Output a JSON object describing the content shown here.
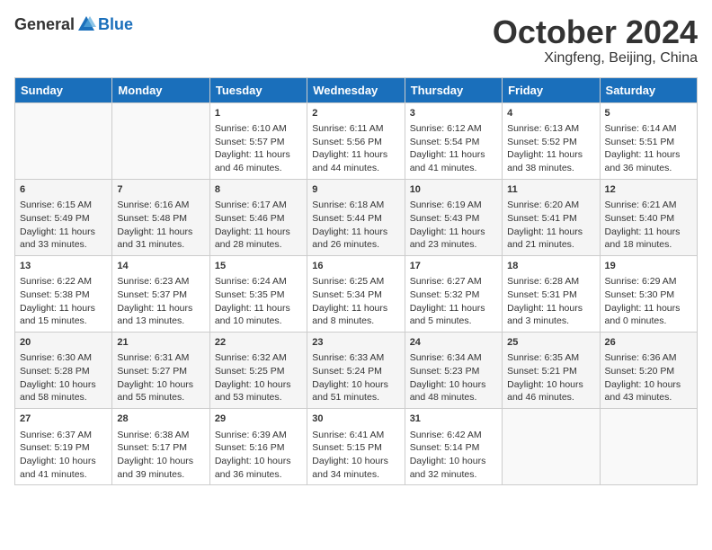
{
  "header": {
    "logo": {
      "general": "General",
      "blue": "Blue"
    },
    "month": "October 2024",
    "location": "Xingfeng, Beijing, China"
  },
  "weekdays": [
    "Sunday",
    "Monday",
    "Tuesday",
    "Wednesday",
    "Thursday",
    "Friday",
    "Saturday"
  ],
  "weeks": [
    [
      {
        "day": "",
        "sunrise": "",
        "sunset": "",
        "daylight": ""
      },
      {
        "day": "",
        "sunrise": "",
        "sunset": "",
        "daylight": ""
      },
      {
        "day": "1",
        "sunrise": "Sunrise: 6:10 AM",
        "sunset": "Sunset: 5:57 PM",
        "daylight": "Daylight: 11 hours and 46 minutes."
      },
      {
        "day": "2",
        "sunrise": "Sunrise: 6:11 AM",
        "sunset": "Sunset: 5:56 PM",
        "daylight": "Daylight: 11 hours and 44 minutes."
      },
      {
        "day": "3",
        "sunrise": "Sunrise: 6:12 AM",
        "sunset": "Sunset: 5:54 PM",
        "daylight": "Daylight: 11 hours and 41 minutes."
      },
      {
        "day": "4",
        "sunrise": "Sunrise: 6:13 AM",
        "sunset": "Sunset: 5:52 PM",
        "daylight": "Daylight: 11 hours and 38 minutes."
      },
      {
        "day": "5",
        "sunrise": "Sunrise: 6:14 AM",
        "sunset": "Sunset: 5:51 PM",
        "daylight": "Daylight: 11 hours and 36 minutes."
      }
    ],
    [
      {
        "day": "6",
        "sunrise": "Sunrise: 6:15 AM",
        "sunset": "Sunset: 5:49 PM",
        "daylight": "Daylight: 11 hours and 33 minutes."
      },
      {
        "day": "7",
        "sunrise": "Sunrise: 6:16 AM",
        "sunset": "Sunset: 5:48 PM",
        "daylight": "Daylight: 11 hours and 31 minutes."
      },
      {
        "day": "8",
        "sunrise": "Sunrise: 6:17 AM",
        "sunset": "Sunset: 5:46 PM",
        "daylight": "Daylight: 11 hours and 28 minutes."
      },
      {
        "day": "9",
        "sunrise": "Sunrise: 6:18 AM",
        "sunset": "Sunset: 5:44 PM",
        "daylight": "Daylight: 11 hours and 26 minutes."
      },
      {
        "day": "10",
        "sunrise": "Sunrise: 6:19 AM",
        "sunset": "Sunset: 5:43 PM",
        "daylight": "Daylight: 11 hours and 23 minutes."
      },
      {
        "day": "11",
        "sunrise": "Sunrise: 6:20 AM",
        "sunset": "Sunset: 5:41 PM",
        "daylight": "Daylight: 11 hours and 21 minutes."
      },
      {
        "day": "12",
        "sunrise": "Sunrise: 6:21 AM",
        "sunset": "Sunset: 5:40 PM",
        "daylight": "Daylight: 11 hours and 18 minutes."
      }
    ],
    [
      {
        "day": "13",
        "sunrise": "Sunrise: 6:22 AM",
        "sunset": "Sunset: 5:38 PM",
        "daylight": "Daylight: 11 hours and 15 minutes."
      },
      {
        "day": "14",
        "sunrise": "Sunrise: 6:23 AM",
        "sunset": "Sunset: 5:37 PM",
        "daylight": "Daylight: 11 hours and 13 minutes."
      },
      {
        "day": "15",
        "sunrise": "Sunrise: 6:24 AM",
        "sunset": "Sunset: 5:35 PM",
        "daylight": "Daylight: 11 hours and 10 minutes."
      },
      {
        "day": "16",
        "sunrise": "Sunrise: 6:25 AM",
        "sunset": "Sunset: 5:34 PM",
        "daylight": "Daylight: 11 hours and 8 minutes."
      },
      {
        "day": "17",
        "sunrise": "Sunrise: 6:27 AM",
        "sunset": "Sunset: 5:32 PM",
        "daylight": "Daylight: 11 hours and 5 minutes."
      },
      {
        "day": "18",
        "sunrise": "Sunrise: 6:28 AM",
        "sunset": "Sunset: 5:31 PM",
        "daylight": "Daylight: 11 hours and 3 minutes."
      },
      {
        "day": "19",
        "sunrise": "Sunrise: 6:29 AM",
        "sunset": "Sunset: 5:30 PM",
        "daylight": "Daylight: 11 hours and 0 minutes."
      }
    ],
    [
      {
        "day": "20",
        "sunrise": "Sunrise: 6:30 AM",
        "sunset": "Sunset: 5:28 PM",
        "daylight": "Daylight: 10 hours and 58 minutes."
      },
      {
        "day": "21",
        "sunrise": "Sunrise: 6:31 AM",
        "sunset": "Sunset: 5:27 PM",
        "daylight": "Daylight: 10 hours and 55 minutes."
      },
      {
        "day": "22",
        "sunrise": "Sunrise: 6:32 AM",
        "sunset": "Sunset: 5:25 PM",
        "daylight": "Daylight: 10 hours and 53 minutes."
      },
      {
        "day": "23",
        "sunrise": "Sunrise: 6:33 AM",
        "sunset": "Sunset: 5:24 PM",
        "daylight": "Daylight: 10 hours and 51 minutes."
      },
      {
        "day": "24",
        "sunrise": "Sunrise: 6:34 AM",
        "sunset": "Sunset: 5:23 PM",
        "daylight": "Daylight: 10 hours and 48 minutes."
      },
      {
        "day": "25",
        "sunrise": "Sunrise: 6:35 AM",
        "sunset": "Sunset: 5:21 PM",
        "daylight": "Daylight: 10 hours and 46 minutes."
      },
      {
        "day": "26",
        "sunrise": "Sunrise: 6:36 AM",
        "sunset": "Sunset: 5:20 PM",
        "daylight": "Daylight: 10 hours and 43 minutes."
      }
    ],
    [
      {
        "day": "27",
        "sunrise": "Sunrise: 6:37 AM",
        "sunset": "Sunset: 5:19 PM",
        "daylight": "Daylight: 10 hours and 41 minutes."
      },
      {
        "day": "28",
        "sunrise": "Sunrise: 6:38 AM",
        "sunset": "Sunset: 5:17 PM",
        "daylight": "Daylight: 10 hours and 39 minutes."
      },
      {
        "day": "29",
        "sunrise": "Sunrise: 6:39 AM",
        "sunset": "Sunset: 5:16 PM",
        "daylight": "Daylight: 10 hours and 36 minutes."
      },
      {
        "day": "30",
        "sunrise": "Sunrise: 6:41 AM",
        "sunset": "Sunset: 5:15 PM",
        "daylight": "Daylight: 10 hours and 34 minutes."
      },
      {
        "day": "31",
        "sunrise": "Sunrise: 6:42 AM",
        "sunset": "Sunset: 5:14 PM",
        "daylight": "Daylight: 10 hours and 32 minutes."
      },
      {
        "day": "",
        "sunrise": "",
        "sunset": "",
        "daylight": ""
      },
      {
        "day": "",
        "sunrise": "",
        "sunset": "",
        "daylight": ""
      }
    ]
  ]
}
